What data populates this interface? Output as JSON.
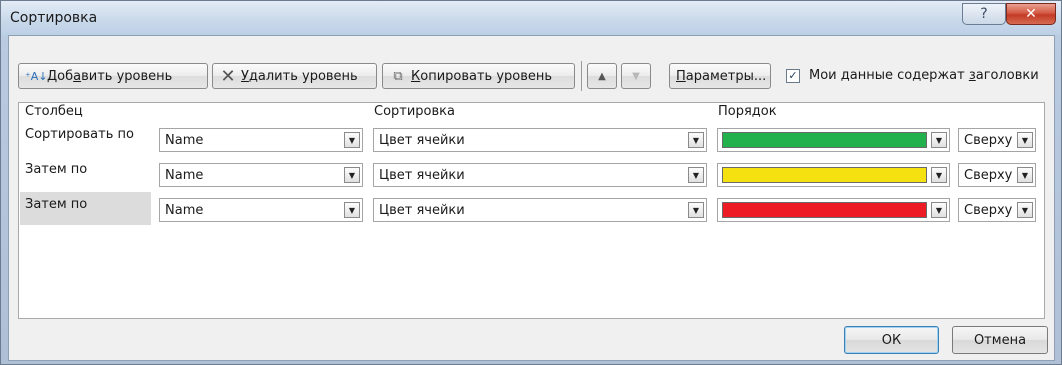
{
  "window": {
    "title": "Сортировка",
    "help_glyph": "?",
    "close_glyph": "✕"
  },
  "toolbar": {
    "add_pre": "Доб",
    "add_key": "а",
    "add_post": "вить уровень",
    "delete_pre": "",
    "delete_key": "У",
    "delete_post": "далить уровень",
    "copy_pre": "",
    "copy_key": "К",
    "copy_post": "опировать уровень",
    "move_up_glyph": "▲",
    "move_down_glyph": "▼",
    "options_pre": "",
    "options_key": "П",
    "options_post": "араметры...",
    "headers_checkbox_pre": "Мои данные содержат ",
    "headers_checkbox_key": "з",
    "headers_checkbox_post": "аголовки",
    "headers_checked": true
  },
  "grid": {
    "headers": {
      "column": "Столбец",
      "sort_on": "Сортировка",
      "order": "Порядок"
    },
    "rows": [
      {
        "label": "Сортировать по",
        "column": "Name",
        "sort_on": "Цвет ячейки",
        "color": "#22b14c",
        "position": "Сверху"
      },
      {
        "label": "Затем по",
        "column": "Name",
        "sort_on": "Цвет ячейки",
        "color": "#f5e10f",
        "position": "Сверху"
      },
      {
        "label": "Затем по",
        "column": "Name",
        "sort_on": "Цвет ячейки",
        "color": "#ed1c24",
        "position": "Сверху"
      }
    ]
  },
  "footer": {
    "ok": "ОК",
    "cancel": "Отмена"
  },
  "colors": {
    "titlebar": "#c8d8ea",
    "dialog_bg": "#f0f0f0",
    "close": "#c23a26"
  },
  "icons": {
    "add": "add-level-icon",
    "delete": "delete-x-icon",
    "copy": "copy-icon",
    "check": "checkmark-icon",
    "dropdown": "chevron-down-icon"
  }
}
